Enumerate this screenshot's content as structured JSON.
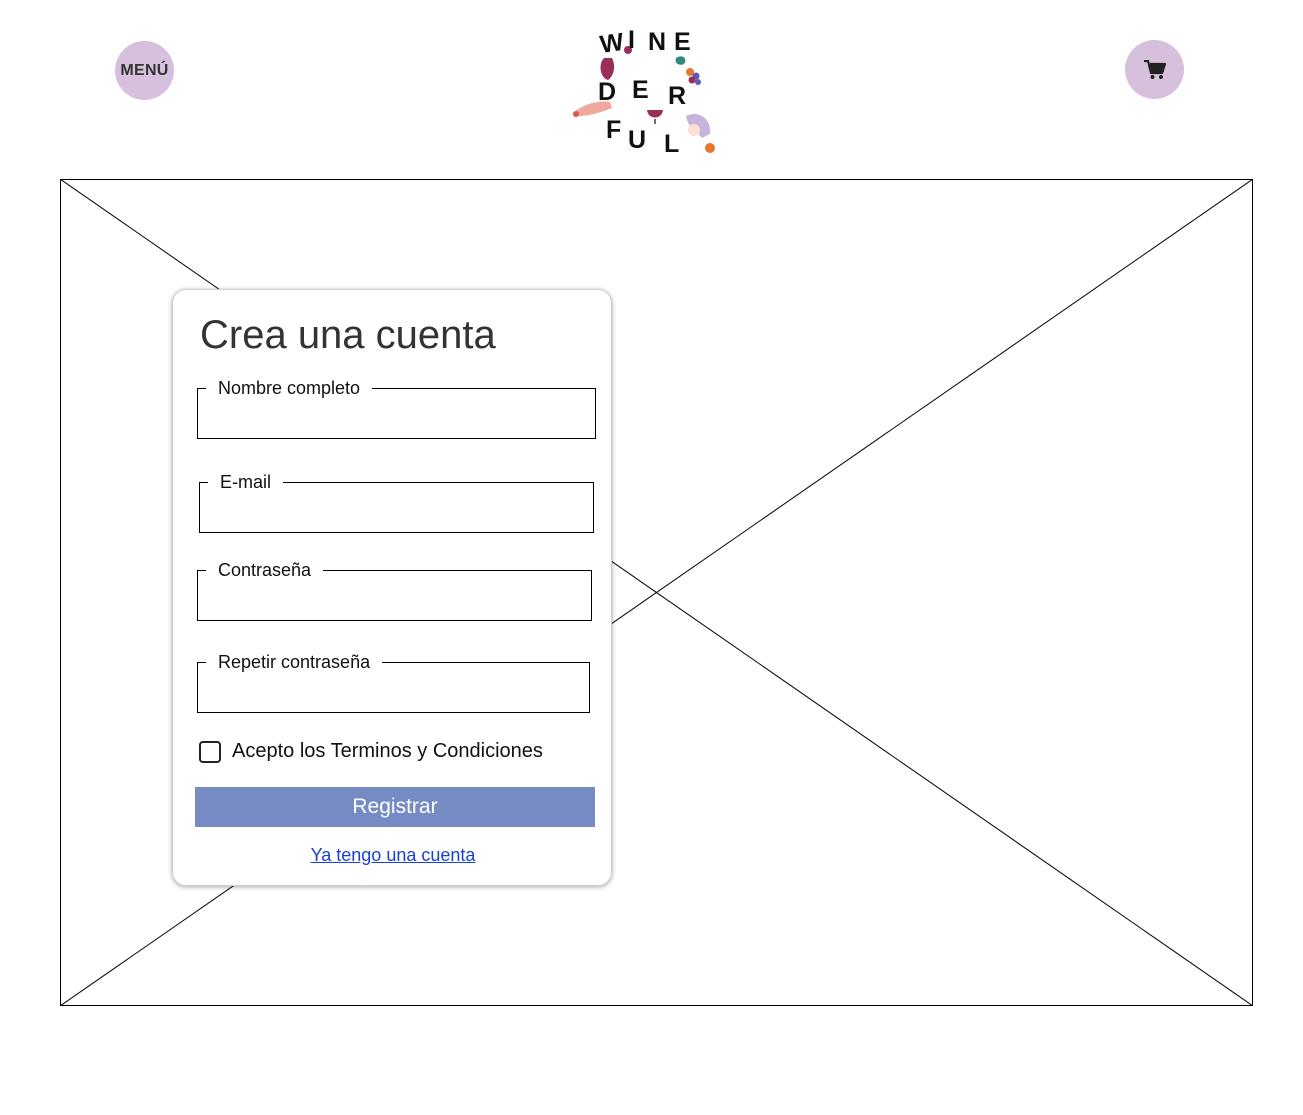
{
  "header": {
    "menu_label": "MENÚ",
    "cart_icon": "cart-icon",
    "logo": {
      "text_lines": [
        "WINE",
        "DER",
        "FUL"
      ],
      "accent_colors": [
        "#9b2d5a",
        "#f0a7a0",
        "#c6b4dc",
        "#e8772e",
        "#2f8a7a"
      ]
    },
    "button_color": "#d7c0de"
  },
  "form": {
    "title": "Crea una cuenta",
    "fields": [
      {
        "label": "Nombre completo",
        "value": ""
      },
      {
        "label": "E-mail",
        "value": ""
      },
      {
        "label": "Contraseña",
        "value": ""
      },
      {
        "label": "Repetir contraseña",
        "value": ""
      }
    ],
    "terms_label": "Acepto los Terminos y Condiciones",
    "terms_checked": false,
    "submit_label": "Registrar",
    "submit_color": "#768bc4",
    "login_link": "Ya tengo una cuenta"
  }
}
